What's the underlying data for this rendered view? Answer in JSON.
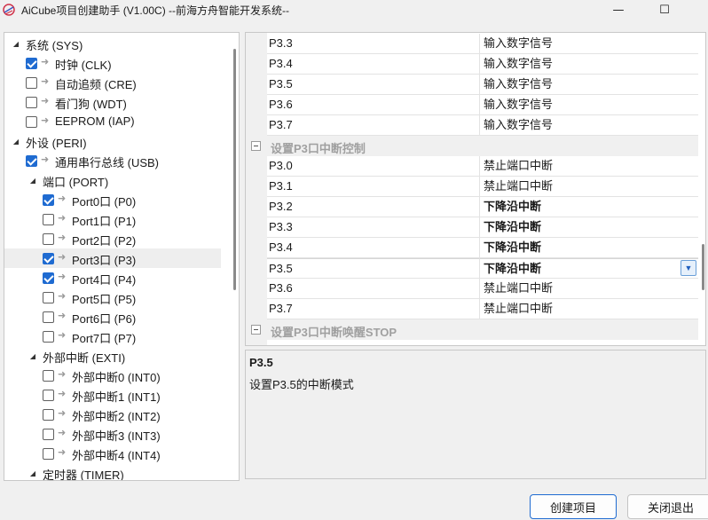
{
  "window": {
    "title": "AiCube项目创建助手 (V1.00C) --前海方舟智能开发系统--",
    "minimize_glyph": "—",
    "maximize_glyph": "☐"
  },
  "tree": {
    "items": [
      {
        "label": "系统 (SYS)",
        "level": 0,
        "expander": "expanded",
        "check": null,
        "arrow": false
      },
      {
        "label": "时钟 (CLK)",
        "level": 1,
        "check": true,
        "arrow": true
      },
      {
        "label": "自动追频 (CRE)",
        "level": 1,
        "check": false,
        "arrow": true
      },
      {
        "label": "看门狗 (WDT)",
        "level": 1,
        "check": false,
        "arrow": true
      },
      {
        "label": "EEPROM (IAP)",
        "level": 1,
        "check": false,
        "arrow": true
      },
      {
        "label": "外设 (PERI)",
        "level": 0,
        "expander": "expanded",
        "check": null,
        "arrow": false
      },
      {
        "label": "通用串行总线 (USB)",
        "level": 1,
        "check": true,
        "arrow": true
      },
      {
        "label": "端口 (PORT)",
        "level": 1,
        "expander": "expanded",
        "check": null,
        "arrow": false
      },
      {
        "label": "Port0口 (P0)",
        "level": 2,
        "check": true,
        "arrow": true
      },
      {
        "label": "Port1口 (P1)",
        "level": 2,
        "check": false,
        "arrow": true
      },
      {
        "label": "Port2口 (P2)",
        "level": 2,
        "check": false,
        "arrow": true
      },
      {
        "label": "Port3口 (P3)",
        "level": 2,
        "check": true,
        "arrow": true,
        "selected": true
      },
      {
        "label": "Port4口 (P4)",
        "level": 2,
        "check": true,
        "arrow": true
      },
      {
        "label": "Port5口 (P5)",
        "level": 2,
        "check": false,
        "arrow": true
      },
      {
        "label": "Port6口 (P6)",
        "level": 2,
        "check": false,
        "arrow": true
      },
      {
        "label": "Port7口 (P7)",
        "level": 2,
        "check": false,
        "arrow": true
      },
      {
        "label": "外部中断 (EXTI)",
        "level": 1,
        "expander": "expanded",
        "check": null,
        "arrow": false
      },
      {
        "label": "外部中断0 (INT0)",
        "level": 2,
        "check": false,
        "arrow": true
      },
      {
        "label": "外部中断1 (INT1)",
        "level": 2,
        "check": false,
        "arrow": true
      },
      {
        "label": "外部中断2 (INT2)",
        "level": 2,
        "check": false,
        "arrow": true
      },
      {
        "label": "外部中断3 (INT3)",
        "level": 2,
        "check": false,
        "arrow": true
      },
      {
        "label": "外部中断4 (INT4)",
        "level": 2,
        "check": false,
        "arrow": true
      },
      {
        "label": "定时器 (TIMER)",
        "level": 1,
        "expander": "expanded",
        "check": null,
        "arrow": false
      }
    ]
  },
  "grid": {
    "rows": [
      {
        "kind": "prop",
        "name": "P3.3",
        "value": "输入数字信号",
        "bold": false
      },
      {
        "kind": "prop",
        "name": "P3.4",
        "value": "输入数字信号",
        "bold": false
      },
      {
        "kind": "prop",
        "name": "P3.5",
        "value": "输入数字信号",
        "bold": false
      },
      {
        "kind": "prop",
        "name": "P3.6",
        "value": "输入数字信号",
        "bold": false
      },
      {
        "kind": "prop",
        "name": "P3.7",
        "value": "输入数字信号",
        "bold": false
      },
      {
        "kind": "category",
        "label": "设置P3口中断控制"
      },
      {
        "kind": "prop",
        "name": "P3.0",
        "value": "禁止端口中断",
        "bold": false
      },
      {
        "kind": "prop",
        "name": "P3.1",
        "value": "禁止端口中断",
        "bold": false
      },
      {
        "kind": "prop",
        "name": "P3.2",
        "value": "下降沿中断",
        "bold": true
      },
      {
        "kind": "prop",
        "name": "P3.3",
        "value": "下降沿中断",
        "bold": true
      },
      {
        "kind": "prop",
        "name": "P3.4",
        "value": "下降沿中断",
        "bold": true
      },
      {
        "kind": "prop",
        "name": "P3.5",
        "value": "下降沿中断",
        "bold": true,
        "active": true
      },
      {
        "kind": "prop",
        "name": "P3.6",
        "value": "禁止端口中断",
        "bold": false
      },
      {
        "kind": "prop",
        "name": "P3.7",
        "value": "禁止端口中断",
        "bold": false
      },
      {
        "kind": "category",
        "label": "设置P3口中断唤醒STOP"
      }
    ]
  },
  "description": {
    "title": "P3.5",
    "text": "设置P3.5的中断模式"
  },
  "buttons": {
    "create": "创建项目",
    "exit": "关闭退出"
  },
  "colors": {
    "accent": "#1f6bd1",
    "category_text": "#a0a0a0"
  }
}
